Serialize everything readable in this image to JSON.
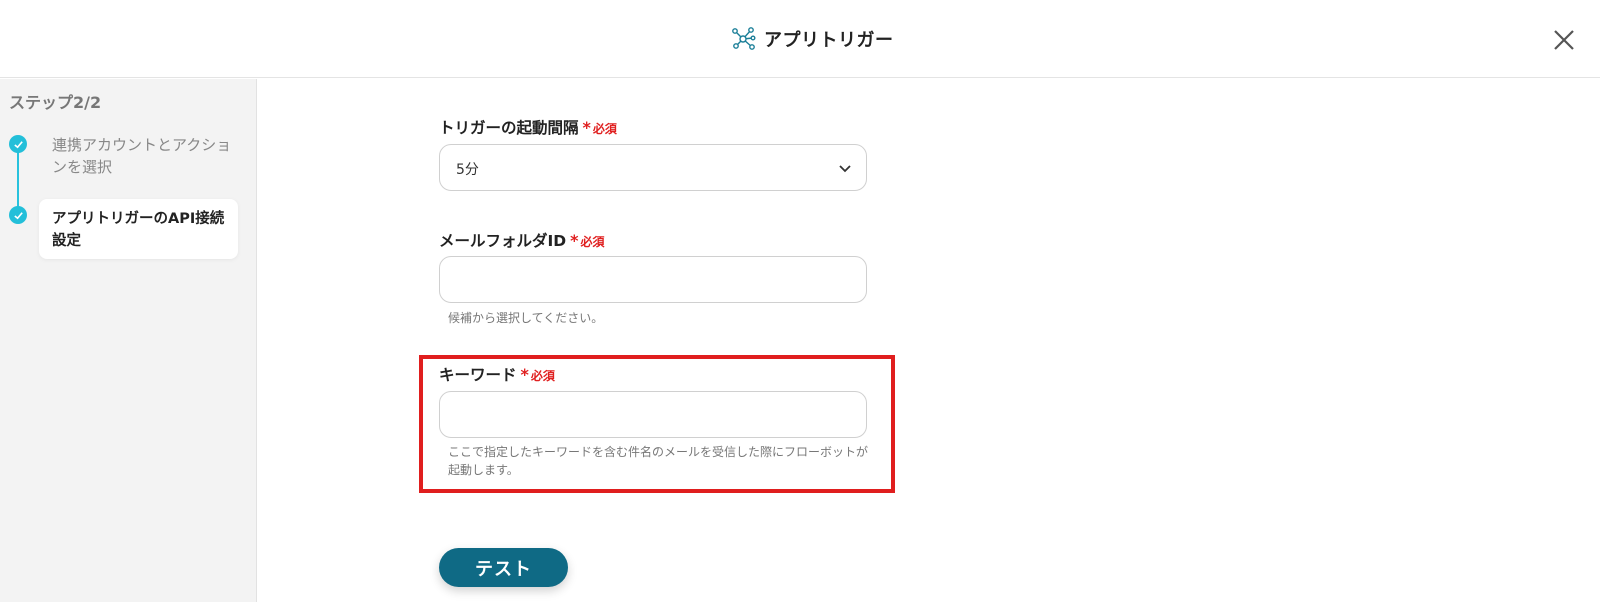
{
  "header": {
    "title": "アプリトリガー",
    "icon": "network-nodes-icon"
  },
  "sidebar": {
    "step_indicator": "ステップ2/2",
    "steps": [
      {
        "label": "連携アカウントとアクションを選択",
        "status": "completed"
      },
      {
        "label": "アプリトリガーのAPI接続設定",
        "status": "completed",
        "active": true
      }
    ]
  },
  "form": {
    "required_label": "必須",
    "interval": {
      "label": "トリガーの起動間隔",
      "value": "5分"
    },
    "folder_id": {
      "label": "メールフォルダID",
      "value": "",
      "hint": "候補から選択してください。"
    },
    "keyword": {
      "label": "キーワード",
      "value": "",
      "hint_line1": "ここで指定したキーワードを含む件名のメールを受信した際にフローボットが",
      "hint_line2": "起動します。"
    },
    "test_button": "テスト"
  },
  "colors": {
    "accent": "#23bfd9",
    "button": "#0f6a85",
    "required": "#e02020",
    "highlight": "#e01e1e"
  }
}
